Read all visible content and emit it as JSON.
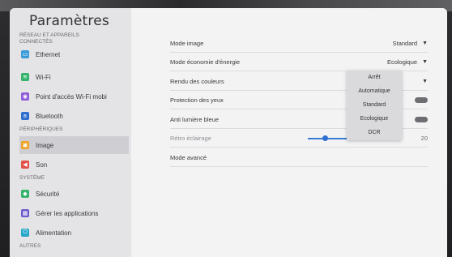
{
  "sidebar": {
    "title": "Paramètres",
    "sections": [
      {
        "title": "RÉSEAU ET APPAREILS CONNECTÉS",
        "items": [
          {
            "label": "Ethernet",
            "icon": "ethernet-icon",
            "color": "#3a9bd9"
          },
          {
            "label": "Wi-Fi",
            "icon": "wifi-icon",
            "color": "#33b36b"
          },
          {
            "label": "Point d'accès Wi-Fi mobi",
            "icon": "hotspot-icon",
            "color": "#8e5bd8"
          },
          {
            "label": "Bluetooth",
            "icon": "bluetooth-icon",
            "color": "#2f6fd0"
          }
        ]
      },
      {
        "title": "PÉRIPHÉRIQUES",
        "items": [
          {
            "label": "Image",
            "icon": "image-icon",
            "color": "#f0a020",
            "active": true
          },
          {
            "label": "Son",
            "icon": "sound-icon",
            "color": "#e4504a"
          }
        ]
      },
      {
        "title": "SYSTÈME",
        "items": [
          {
            "label": "Sécurité",
            "icon": "security-icon",
            "color": "#33b36b"
          },
          {
            "label": "Gérer les applications",
            "icon": "apps-icon",
            "color": "#6a5acd"
          },
          {
            "label": "Alimentation",
            "icon": "power-icon",
            "color": "#26a6c9"
          }
        ]
      },
      {
        "title": "AUTRES",
        "items": []
      }
    ]
  },
  "main": {
    "rows": [
      {
        "label": "Mode image",
        "value": "Standard",
        "kind": "select"
      },
      {
        "label": "Mode économie d'énergie",
        "value": "Ecologique",
        "kind": "select"
      },
      {
        "label": "Rendu des couleurs",
        "kind": "select"
      },
      {
        "label": "Protection des yeux",
        "kind": "toggle"
      },
      {
        "label": "Anti lumière bleue",
        "kind": "toggle"
      },
      {
        "label": "Rétro éclairage",
        "kind": "slider",
        "value": "20"
      },
      {
        "label": "Mode avancé",
        "kind": "link"
      }
    ],
    "slider_level": 0.18,
    "dropdown": {
      "options": [
        "Arrêt",
        "Automatique",
        "Standard",
        "Ecologique",
        "DCR"
      ]
    }
  },
  "colors": {
    "accent": "#2f6fd0",
    "active_bg": "#cfcfd3"
  }
}
